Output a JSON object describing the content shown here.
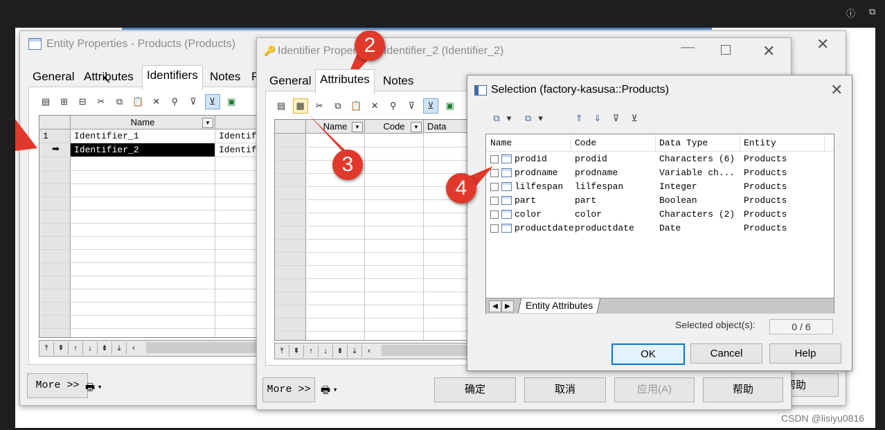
{
  "top": {
    "info_icon": "info-icon",
    "ext_icon": "extension-icon"
  },
  "win1": {
    "title": "Entity Properties - Products (Products)",
    "tabs": [
      "General",
      "Attributes",
      "Identifiers",
      "Notes",
      "R"
    ],
    "col_name": "Name",
    "col_code": "Identifi",
    "rows": [
      {
        "num": "1",
        "name": "Identifier_1",
        "code": "Identifi"
      },
      {
        "num": "",
        "name": "Identifier_2",
        "code": "Identifi"
      }
    ],
    "more": "More >>",
    "help_partial": "帮助"
  },
  "win2": {
    "title": "Identifier Properties - Identifier_2 (Identifier_2)",
    "tabs": [
      "General",
      "Attributes",
      "Notes"
    ],
    "col_name": "Name",
    "col_code": "Code",
    "col_data": "Data",
    "more": "More >>",
    "ok": "确定",
    "cancel": "取消",
    "apply": "应用(A)",
    "help": "帮助"
  },
  "sel": {
    "title": "Selection (factory-kasusa::Products)",
    "headers": [
      "Name",
      "Code",
      "Data Type",
      "Entity"
    ],
    "rows": [
      {
        "name": "prodid",
        "code": "prodid",
        "type": "Characters (6)",
        "entity": "Products"
      },
      {
        "name": "prodname",
        "code": "prodname",
        "type": "Variable ch...",
        "entity": "Products"
      },
      {
        "name": "lilfespan",
        "code": "lilfespan",
        "type": "Integer",
        "entity": "Products"
      },
      {
        "name": "part",
        "code": "part",
        "type": "Boolean",
        "entity": "Products"
      },
      {
        "name": "color",
        "code": "color",
        "type": "Characters (2)",
        "entity": "Products"
      },
      {
        "name": "productdate",
        "code": "productdate",
        "type": "Date",
        "entity": "Products"
      }
    ],
    "sheet_tab": "Entity Attributes",
    "selected_label": "Selected object(s):",
    "selected_value": "0 / 6",
    "ok": "OK",
    "cancel": "Cancel",
    "help": "Help"
  },
  "badges": [
    "2",
    "3",
    "4"
  ],
  "watermark": "CSDN @lisiyu0816",
  "colors": {
    "badge": "#e0392b",
    "accent": "#0078d7"
  }
}
